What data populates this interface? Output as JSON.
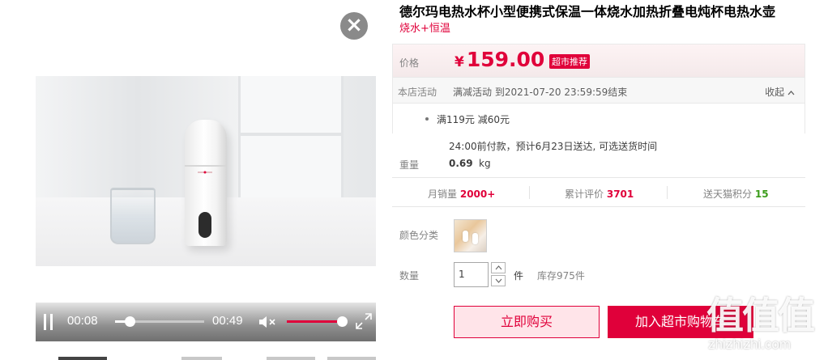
{
  "product": {
    "title": "德尔玛电热水杯小型便携式保温一体烧水加热折叠电炖杯电热水壶",
    "subtitle": "烧水+恒温"
  },
  "video": {
    "current_time": "00:08",
    "duration": "00:49",
    "progress_fraction": 0.163,
    "volume_fraction": 0.95
  },
  "price": {
    "label": "价格",
    "currency": "¥",
    "value": "159.00",
    "badge": "超市推荐"
  },
  "promo": {
    "label": "本店活动",
    "text": "满减活动 到2021-07-20 23:59:59结束",
    "collapse": "收起",
    "detail": "满119元 减60元"
  },
  "shipping": "24:00前付款，预计6月23日送达, 可选送货时间",
  "weight": {
    "label": "重量",
    "value": "0.69",
    "unit": "kg"
  },
  "stats": [
    {
      "label": "月销量",
      "value": "2000+",
      "color": "#e0003a"
    },
    {
      "label": "累计评价",
      "value": "3701",
      "color": "#e0003a"
    },
    {
      "label": "送天猫积分",
      "value": "15",
      "color": "#3b9c1b"
    }
  ],
  "color_option": {
    "label": "颜色分类"
  },
  "quantity": {
    "label": "数量",
    "value": "1",
    "unit": "件",
    "stock": "库存975件"
  },
  "buttons": {
    "buy": "立即购买",
    "cart": "加入超市购物车"
  },
  "watermark": {
    "main": "值值值",
    "sub": "zhizhizhi.com"
  },
  "colors": {
    "accent": "#e0003a",
    "points": "#3b9c1b"
  }
}
